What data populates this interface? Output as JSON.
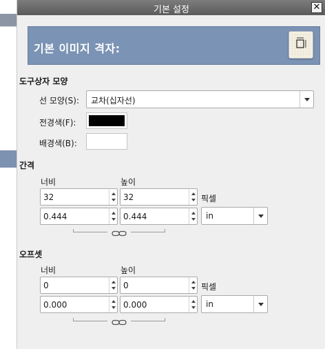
{
  "window": {
    "title": "기본 설정"
  },
  "header": {
    "title": "기본 이미지 격자:",
    "icon": "grid-icon"
  },
  "appearance": {
    "section_label": "도구상자 모양",
    "line_style": {
      "label": "선 모양(S):",
      "value": "교차(십자선)"
    },
    "foreground": {
      "label": "전경색(F):",
      "color": "#000000"
    },
    "background": {
      "label": "배경색(B):",
      "color": "#ffffff"
    }
  },
  "spacing": {
    "section_label": "간격",
    "width_label": "너비",
    "height_label": "높이",
    "width_px": "32",
    "height_px": "32",
    "unit_px": "픽셀",
    "width_unit": "0.444",
    "height_unit": "0.444",
    "unit": "in"
  },
  "offset": {
    "section_label": "오프셋",
    "width_label": "너비",
    "height_label": "높이",
    "width_px": "0",
    "height_px": "0",
    "unit_px": "픽셀",
    "width_unit": "0.000",
    "height_unit": "0.000",
    "unit": "in"
  }
}
